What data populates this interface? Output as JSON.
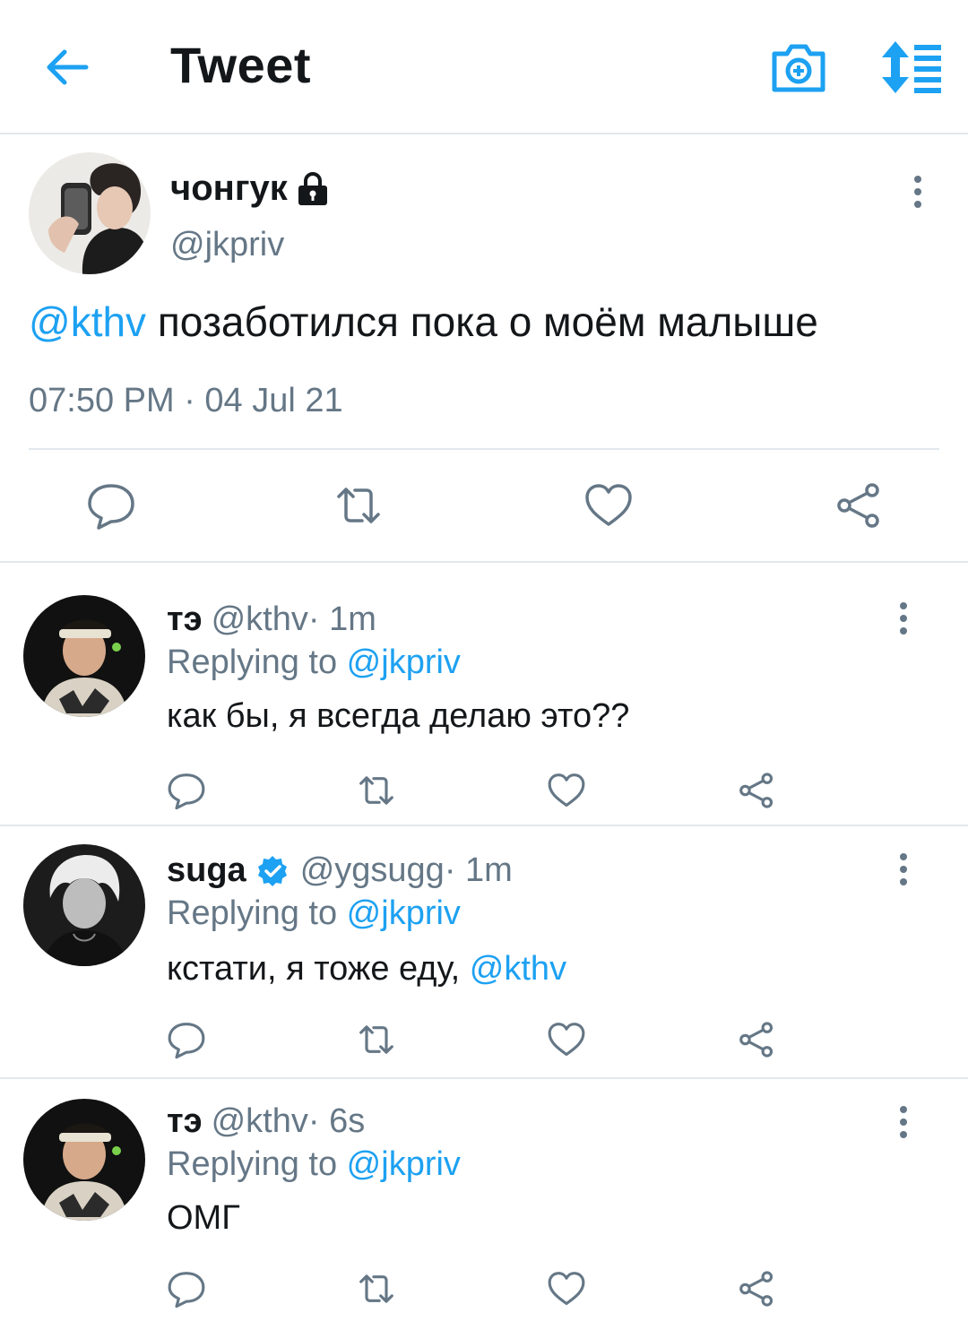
{
  "header": {
    "title": "Tweet"
  },
  "colors": {
    "accent": "#1da1f2",
    "muted": "#657786",
    "text": "#14171a",
    "divider": "#e1e8ed"
  },
  "main_tweet": {
    "author_name": "чонгук",
    "author_handle": "@jkpriv",
    "mention": "@kthv",
    "body": " позаботился пока о моём малыше",
    "timestamp": "07:50 PM · 04 Jul 21",
    "locked": true
  },
  "replies": [
    {
      "name": "тэ",
      "handle": "@kthv",
      "time": " · 1m",
      "verified": false,
      "replying_label": "Replying to ",
      "replying_to": "@jkpriv",
      "text": "как бы, я всегда делаю это??",
      "mention": ""
    },
    {
      "name": "suga",
      "handle": "@ygsugg",
      "time": " · 1m",
      "verified": true,
      "replying_label": "Replying to ",
      "replying_to": "@jkpriv",
      "text": "кстати, я тоже еду, ",
      "mention": "@kthv"
    },
    {
      "name": "тэ",
      "handle": "@kthv",
      "time": " · 6s",
      "verified": false,
      "replying_label": "Replying to ",
      "replying_to": "@jkpriv",
      "text": "ОМГ",
      "mention": ""
    }
  ],
  "icons": {
    "back": "arrow-left-icon",
    "camera": "camera-icon",
    "sort": "sort-icon",
    "more": "more-vertical-icon",
    "lock": "lock-icon",
    "verified": "verified-badge-icon",
    "reply": "reply-icon",
    "retweet": "retweet-icon",
    "like": "heart-icon",
    "share": "share-icon"
  }
}
